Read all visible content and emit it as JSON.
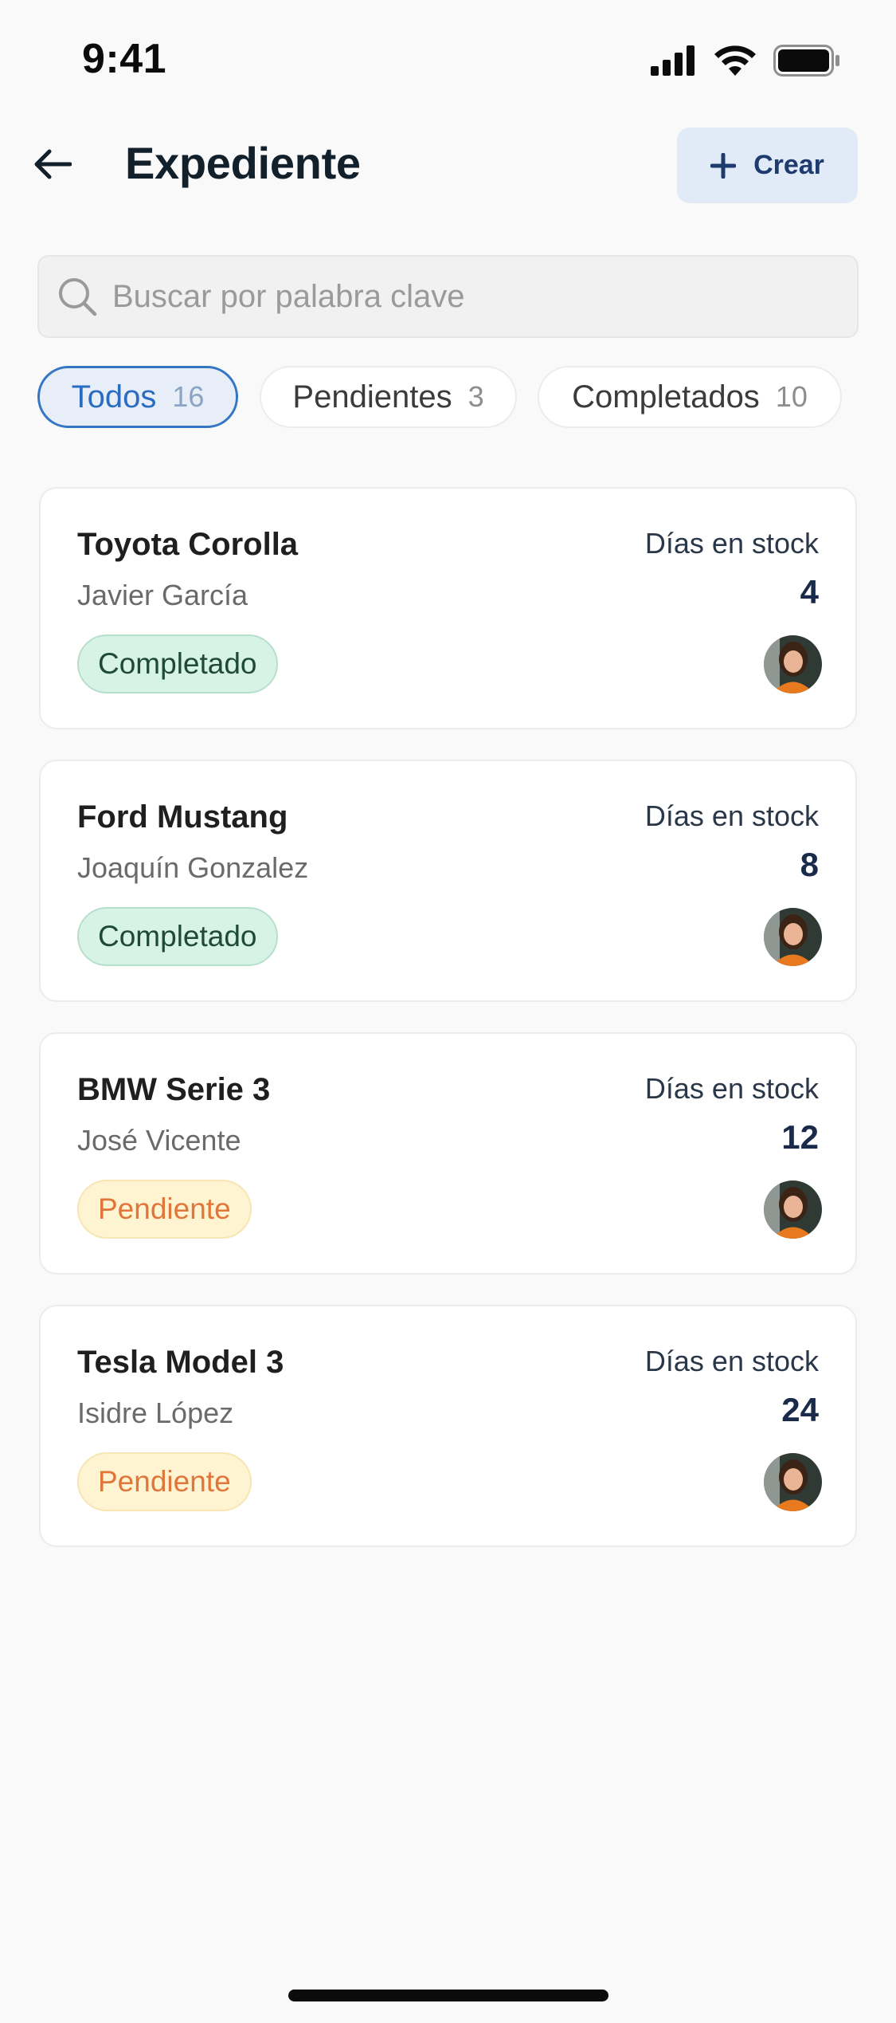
{
  "status_bar": {
    "time": "9:41"
  },
  "header": {
    "title": "Expediente",
    "create_label": "Crear"
  },
  "search": {
    "placeholder": "Buscar por palabra clave"
  },
  "filters": [
    {
      "label": "Todos",
      "count": "16",
      "active": true
    },
    {
      "label": "Pendientes",
      "count": "3",
      "active": false
    },
    {
      "label": "Completados",
      "count": "10",
      "active": false
    }
  ],
  "cards": [
    {
      "title": "Toyota Corolla",
      "owner": "Javier García",
      "status": "Completado",
      "days_label": "Días en stock",
      "days": "4"
    },
    {
      "title": "Ford Mustang",
      "owner": "Joaquín Gonzalez",
      "status": "Completado",
      "days_label": "Días en stock",
      "days": "8"
    },
    {
      "title": "BMW Serie 3",
      "owner": "José Vicente",
      "status": "Pendiente",
      "days_label": "Días en stock",
      "days": "12"
    },
    {
      "title": "Tesla Model 3",
      "owner": "Isidre López",
      "status": "Pendiente",
      "days_label": "Días en stock",
      "days": "24"
    }
  ],
  "colors": {
    "accent": "#3475c4",
    "completed_bg": "#d7f2e7",
    "pending_bg": "#fff4d2",
    "pending_text": "#e0763a"
  },
  "icons": [
    "signal-icon",
    "wifi-icon",
    "battery-icon",
    "back-arrow-icon",
    "plus-icon",
    "search-icon",
    "avatar"
  ]
}
